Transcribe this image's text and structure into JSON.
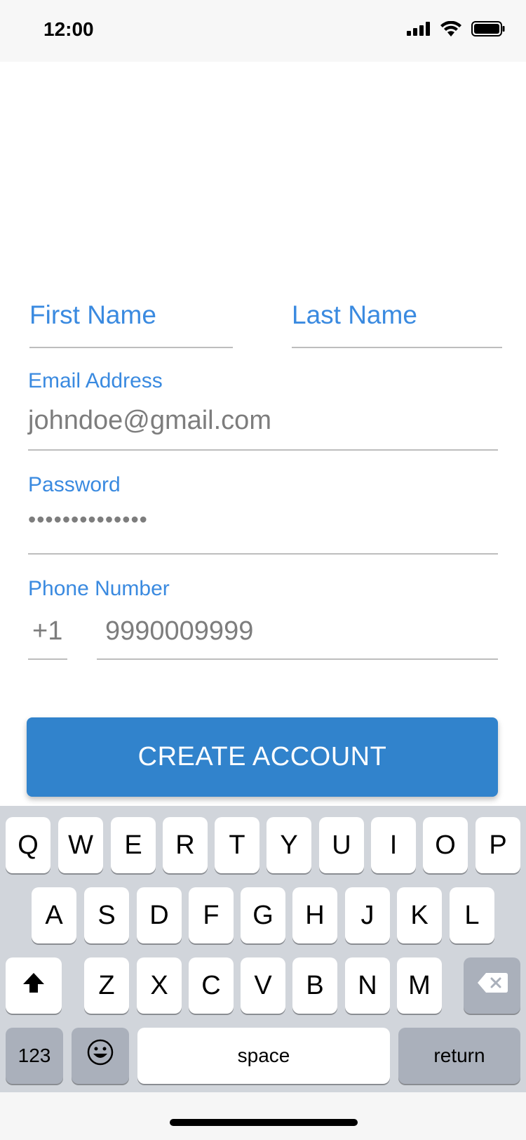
{
  "status": {
    "time": "12:00"
  },
  "form": {
    "first_name_placeholder": "First Name",
    "last_name_placeholder": "Last Name",
    "email_label": "Email Address",
    "email_value": "johndoe@gmail.com",
    "password_label": "Password",
    "password_value": "••••••••••••••",
    "phone_label": "Phone Number",
    "country_code": "+1",
    "phone_value": "9990009999"
  },
  "cta_label": "CREATE ACCOUNT",
  "keyboard": {
    "row1": [
      "Q",
      "W",
      "E",
      "R",
      "T",
      "Y",
      "U",
      "I",
      "O",
      "P"
    ],
    "row2": [
      "A",
      "S",
      "D",
      "F",
      "G",
      "H",
      "J",
      "K",
      "L"
    ],
    "row3": [
      "Z",
      "X",
      "C",
      "V",
      "B",
      "N",
      "M"
    ],
    "numbers_key": "123",
    "space_key": "space",
    "return_key": "return"
  },
  "icons": {
    "signal": "signal-icon",
    "wifi": "wifi-icon",
    "battery": "battery-icon",
    "shift": "shift-icon",
    "backspace": "backspace-icon",
    "emoji": "emoji-icon"
  }
}
